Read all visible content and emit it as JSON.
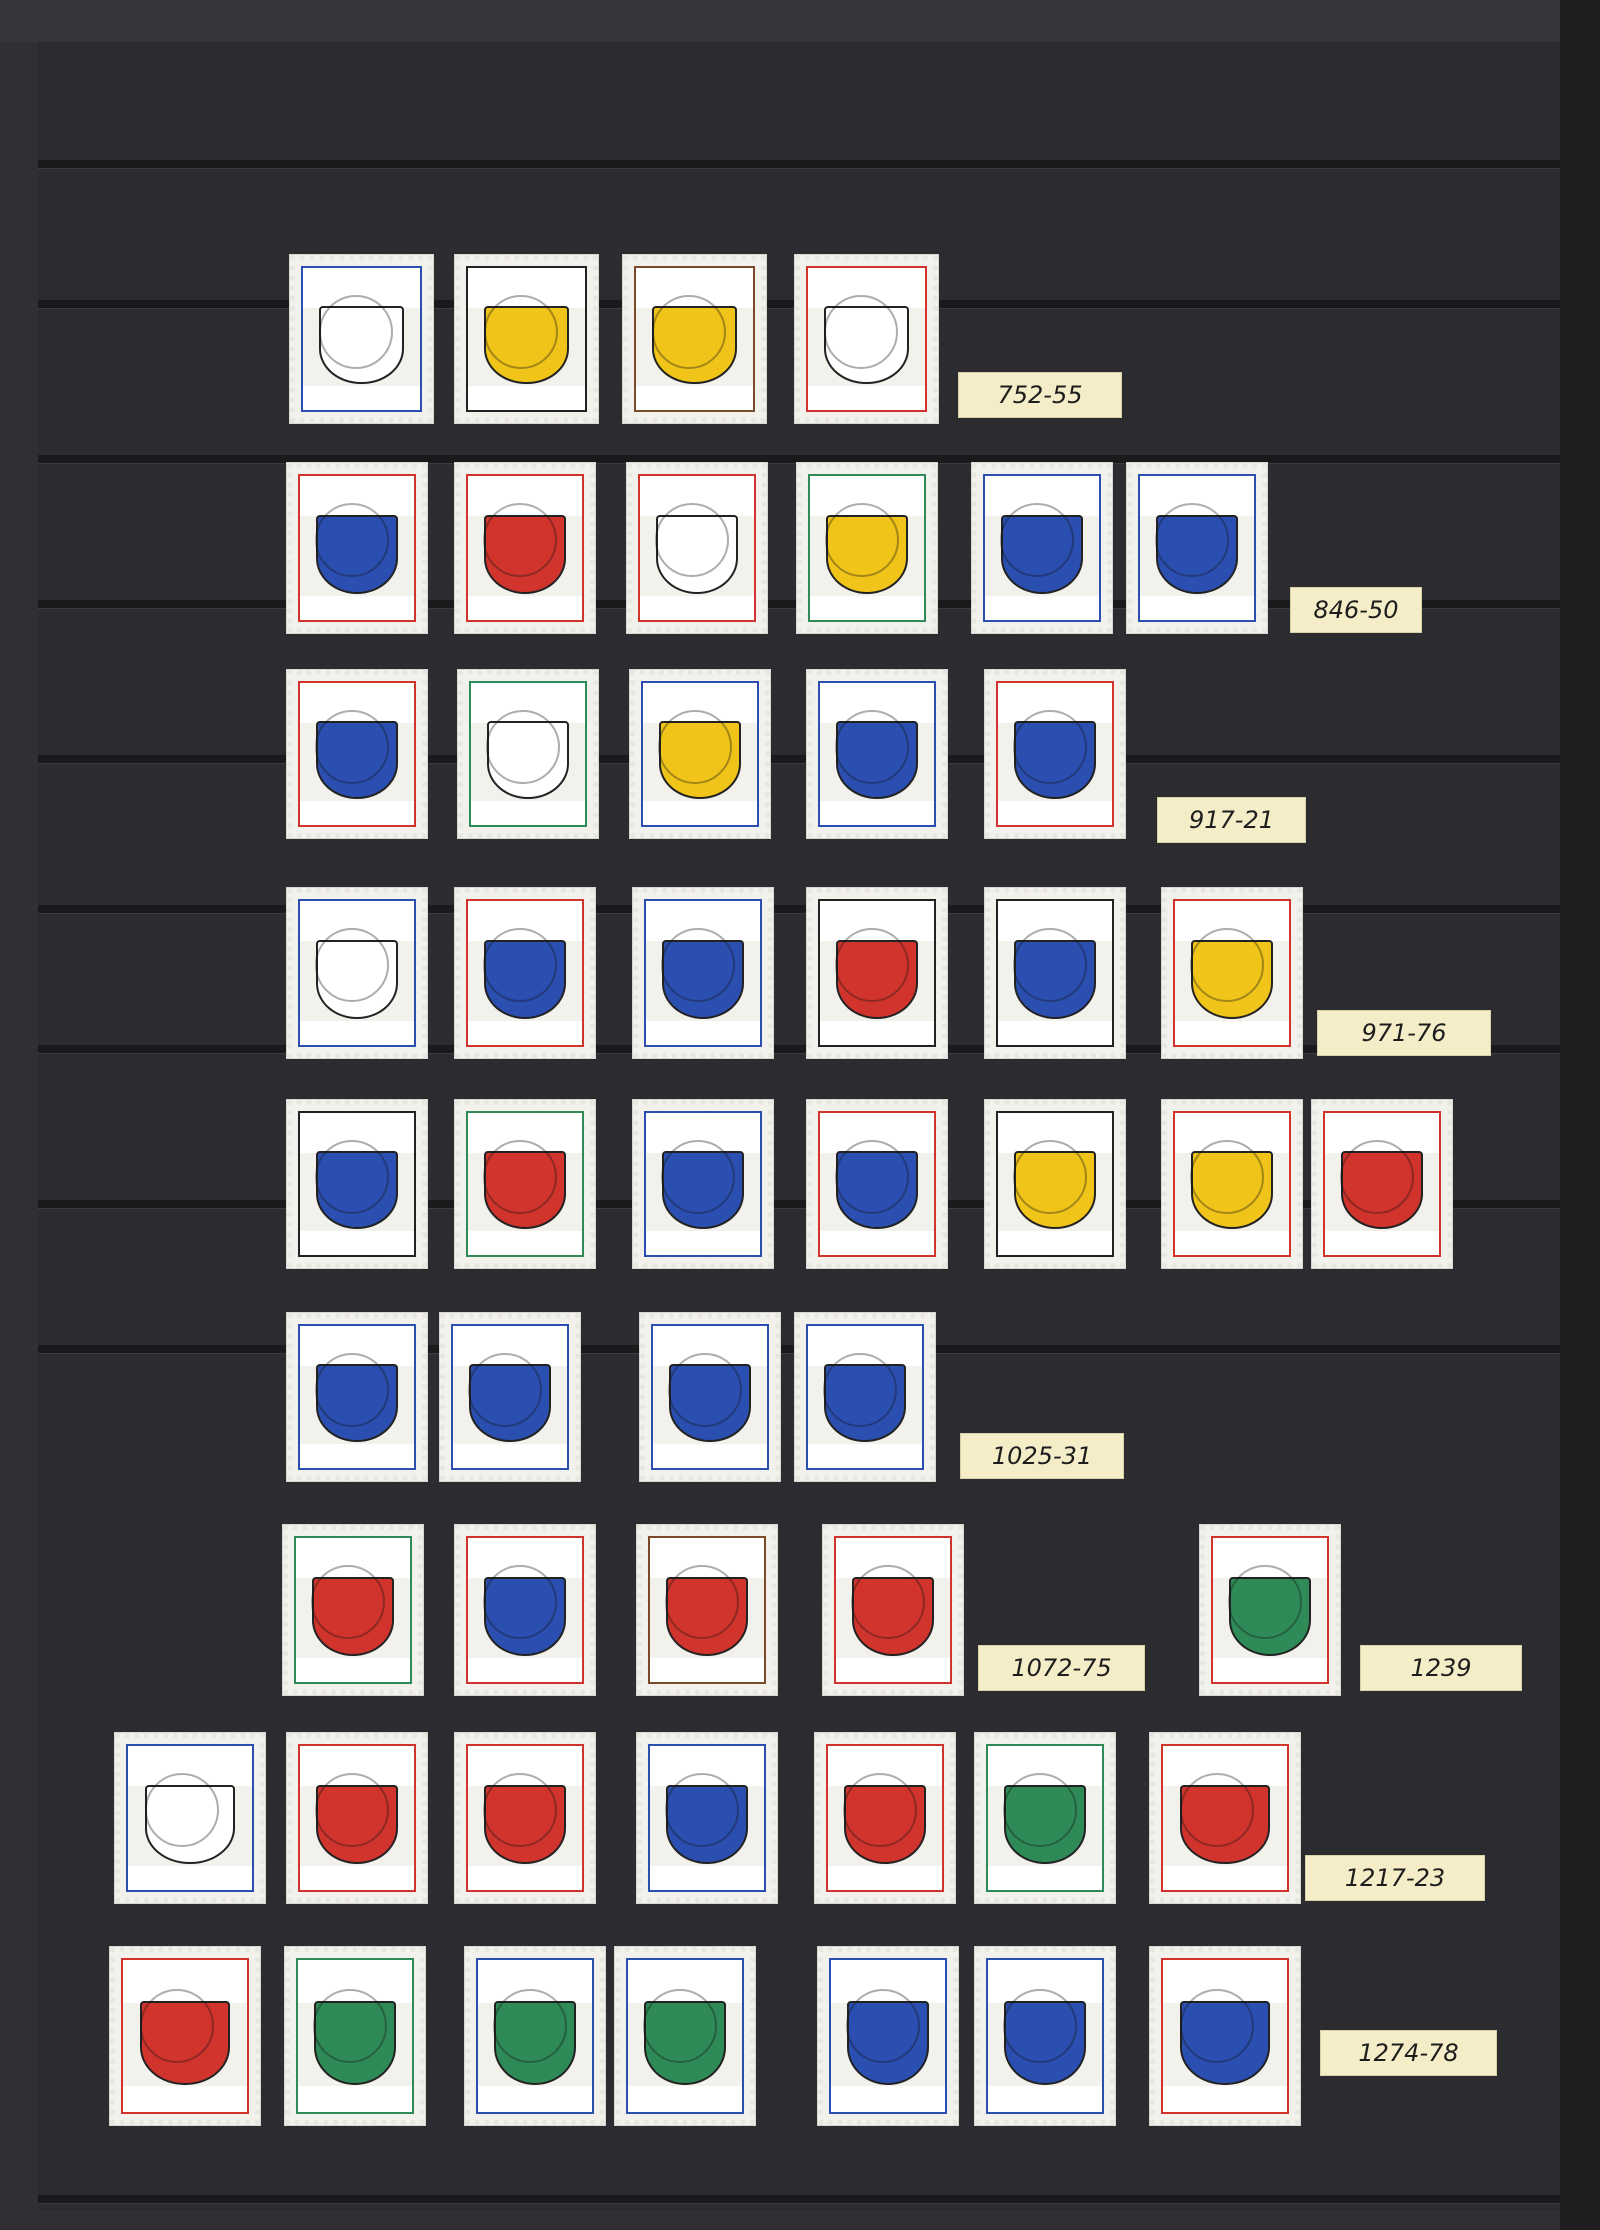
{
  "album": {
    "rows": [
      {
        "label": "752-55"
      },
      {
        "label": "846-50"
      },
      {
        "label": "917-21"
      },
      {
        "label": "971-76"
      },
      {
        "label": ""
      },
      {
        "label": "1025-31"
      },
      {
        "label": "1072-75"
      },
      {
        "label": "1217-23"
      },
      {
        "label": "1274-78"
      }
    ],
    "extra_label": "1239"
  },
  "colors": {
    "background": "#2c2c30",
    "strip": "#1a1a1d",
    "label_paper": "#f4edc8",
    "stamp_blue": "#2a4fb0",
    "stamp_red": "#d0342c",
    "stamp_yellow": "#f0c419",
    "stamp_green": "#2e8b57",
    "stamp_brown": "#7a4a2b"
  }
}
